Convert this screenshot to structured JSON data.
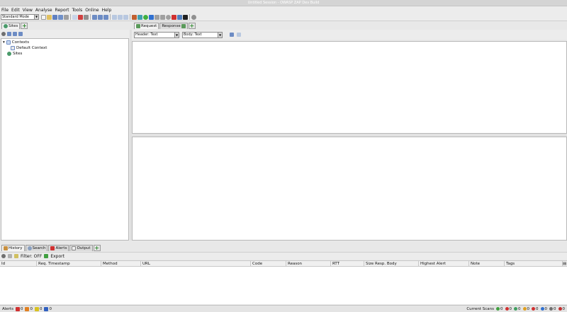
{
  "window": {
    "title": "Untitled Session - OWASP ZAP Dev Build"
  },
  "menu": [
    "File",
    "Edit",
    "View",
    "Analyse",
    "Report",
    "Tools",
    "Online",
    "Help"
  ],
  "toolbar": {
    "mode": "Standard Mode"
  },
  "sites_tabs": {
    "sites_label": "Sites"
  },
  "tree": {
    "contexts": "Contexts",
    "default_context": "Default Context",
    "sites": "Sites"
  },
  "workspace_tabs": {
    "request": "Request",
    "response": "Response"
  },
  "request_view": {
    "header_format": "Header: Text",
    "body_format": "Body: Text"
  },
  "bottom_tabs": {
    "history": "History",
    "search": "Search",
    "alerts": "Alerts",
    "output": "Output"
  },
  "history_toolbar": {
    "filter": "Filter: OFF",
    "export": "Export"
  },
  "history_columns": [
    "Id",
    "Req. Timestamp",
    "Method",
    "URL",
    "Code",
    "Reason",
    "RTT",
    "Size Resp. Body",
    "Highest Alert",
    "Note",
    "Tags"
  ],
  "status": {
    "alerts_label": "Alerts",
    "alert_counts": [
      "0",
      "0",
      "0",
      "0"
    ],
    "current_scans_label": "Current Scans",
    "scan_counts": [
      "0",
      "0",
      "0",
      "0",
      "0",
      "0",
      "0",
      "0"
    ]
  },
  "colors": {
    "accent_green": "#2e8b2e",
    "flag_red": "#d03030",
    "flag_orange": "#e08020",
    "flag_yellow": "#d8c020",
    "flag_blue": "#3060c0"
  }
}
